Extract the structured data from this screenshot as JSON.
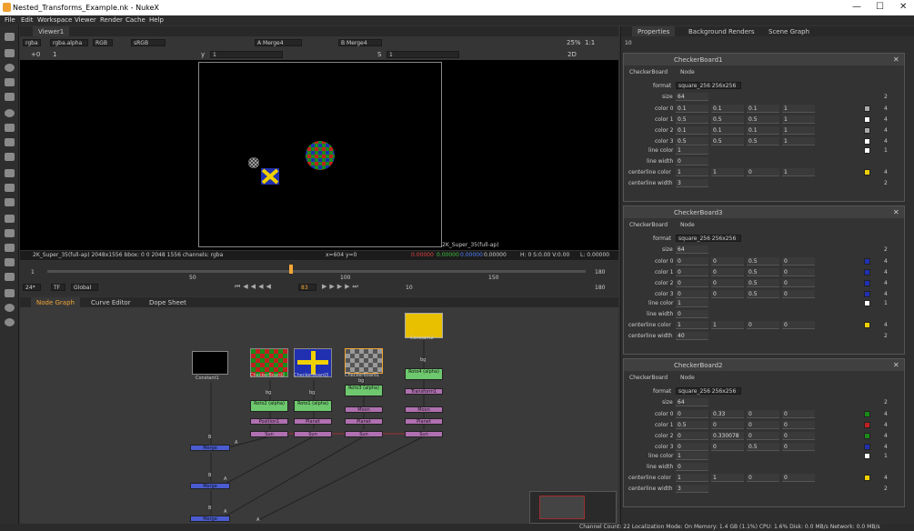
{
  "app": {
    "title": "Nested_Transforms_Example.nk - NukeX"
  },
  "menu": [
    "File",
    "Edit",
    "Workspace",
    "Viewer",
    "Render",
    "Cache",
    "Help"
  ],
  "viewer": {
    "tab": "Viewer1",
    "channels": "rgba",
    "alpha": "rgba.alpha",
    "rgb": "RGB",
    "colorspace": "sRGB",
    "a_input": "A Merge4",
    "b_input": "B Merge4",
    "zoom": "25%",
    "ratio": "1:1",
    "gain": "+0",
    "frame": "1",
    "y_label": "y",
    "y_val": "1",
    "s_label": "S",
    "s_val": "1",
    "mode": "2D",
    "format_label": "2K_Super_35(full-ap)",
    "info": "2K_Super_35(full-ap) 2048x1556  bbox: 0 0 2048 1556 channels: rgba",
    "coord": "x=604 y=0",
    "pix1": "0.00000",
    "pix2": "0.00000",
    "pix3": "0.00000",
    "pix4": "0.00000",
    "hsv": "H:  0 S:0.00 V:0.00",
    "lum": "L: 0.00000"
  },
  "timeline": {
    "start": "1",
    "end": "180",
    "current": "83",
    "ticks": [
      "50",
      "100",
      "150"
    ],
    "fps": "24*",
    "tf": "TF",
    "scope": "Global",
    "step": "10",
    "end2": "180"
  },
  "bottom_tabs": [
    "Node Graph",
    "Curve Editor",
    "Dope Sheet"
  ],
  "nodes": {
    "constant1": "Constant1",
    "constant2": "Constant2",
    "cb1": "CheckerBoard1",
    "cb2": "CheckerBoard2",
    "cb3": "CheckerBoard3",
    "roto1": "Roto1 (alpha)",
    "roto2": "Roto2 (alpha)",
    "roto3": "Roto3 (alpha)",
    "roto4": "Roto4 (alpha)",
    "bg": "bg",
    "b": "B",
    "a": "A",
    "planet": "Planet",
    "moon": "Moon",
    "sun": "Sun",
    "position1": "Position1",
    "transform1": "Transform1",
    "merge": "Merge"
  },
  "properties": {
    "tabs": [
      "Properties",
      "Background Renders",
      "Scene Graph"
    ],
    "count": "10",
    "panels": [
      {
        "name": "CheckerBoard1",
        "tab": "CheckerBoard",
        "tab2": "Node",
        "format": "square_256 256x256",
        "size": "64",
        "rows": [
          [
            "color 0",
            "0.1",
            "0.1",
            "0.1",
            "1"
          ],
          [
            "color 1",
            "0.5",
            "0.5",
            "0.5",
            "1"
          ],
          [
            "color 2",
            "0.1",
            "0.1",
            "0.1",
            "1"
          ],
          [
            "color 3",
            "0.5",
            "0.5",
            "0.5",
            "1"
          ]
        ],
        "line_color": "1",
        "line_width": "0",
        "centerline_color": [
          "1",
          "1",
          "0",
          "1"
        ],
        "centerline_width": "3"
      },
      {
        "name": "CheckerBoard3",
        "tab": "CheckerBoard",
        "tab2": "Node",
        "format": "square_256 256x256",
        "size": "64",
        "rows": [
          [
            "color 0",
            "0",
            "0",
            "0.5",
            "0"
          ],
          [
            "color 1",
            "0",
            "0",
            "0.5",
            "0"
          ],
          [
            "color 2",
            "0",
            "0",
            "0.5",
            "0"
          ],
          [
            "color 3",
            "0",
            "0",
            "0.5",
            "0"
          ]
        ],
        "line_color": "1",
        "line_width": "0",
        "centerline_color": [
          "1",
          "1",
          "0",
          "0"
        ],
        "centerline_width": "40"
      },
      {
        "name": "CheckerBoard2",
        "tab": "CheckerBoard",
        "tab2": "Node",
        "format": "square_256 256x256",
        "size": "64",
        "rows": [
          [
            "color 0",
            "0",
            "0.33",
            "0",
            "0"
          ],
          [
            "color 1",
            "0.5",
            "0",
            "0",
            "0"
          ],
          [
            "color 2",
            "0",
            "0.330078",
            "0",
            "0"
          ],
          [
            "color 3",
            "0",
            "0",
            "0.5",
            "0"
          ]
        ],
        "line_color": "1",
        "line_width": "0",
        "centerline_color": [
          "1",
          "1",
          "0",
          "0"
        ],
        "centerline_width": "3"
      }
    ],
    "labels": {
      "format": "format",
      "size": "size",
      "line_color": "line color",
      "line_width": "line width",
      "centerline_color": "centerline color",
      "centerline_width": "centerline width",
      "one": "1",
      "two": "2",
      "four": "4"
    }
  },
  "statusbar": "Channel Count: 22  Localization Mode: On  Memory: 1.4 GB (1.1%)  CPU: 1.6%  Disk: 0.0 MB/s  Network: 0.0 MB/s"
}
